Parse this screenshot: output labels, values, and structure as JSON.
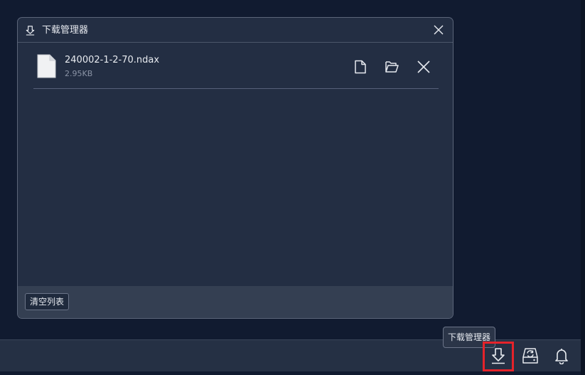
{
  "download_manager": {
    "title": "下载管理器",
    "files": [
      {
        "name": "240002-1-2-70.ndax",
        "size": "2.95KB"
      }
    ],
    "clear_label": "清空列表"
  },
  "bottom_bar": {
    "tooltip": "下载管理器",
    "icons": [
      "download-icon",
      "sync-drive-icon",
      "bell-icon"
    ],
    "highlight_color": "#e5232a"
  },
  "colors": {
    "background": "#111b30",
    "panel": "#232e43",
    "footer": "#343f52"
  }
}
